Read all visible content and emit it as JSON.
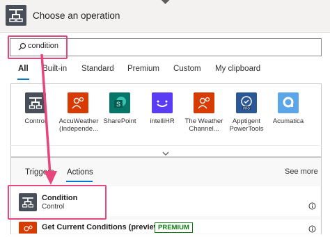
{
  "header": {
    "title": "Choose an operation"
  },
  "search": {
    "value": "condition"
  },
  "tabs": [
    "All",
    "Built-in",
    "Standard",
    "Premium",
    "Custom",
    "My clipboard"
  ],
  "connectors": [
    {
      "label": "Control",
      "color": "#484f58",
      "icon": "control-icon"
    },
    {
      "label": "AccuWeather (Independe...",
      "color": "#d83b01",
      "icon": "accuweather-icon"
    },
    {
      "label": "SharePoint",
      "color": "#077568",
      "icon": "sharepoint-icon"
    },
    {
      "label": "intelliHR",
      "color": "#5b3cf5",
      "icon": "intellihr-icon"
    },
    {
      "label": "The Weather Channel...",
      "color": "#d83b01",
      "icon": "weather-channel-icon"
    },
    {
      "label": "Apptigent PowerTools",
      "color": "#2b5797",
      "icon": "apptigent-icon"
    },
    {
      "label": "Acumatica",
      "color": "#5aa6e8",
      "icon": "acumatica-icon"
    }
  ],
  "subtabs": {
    "triggers": "Triggers",
    "actions": "Actions"
  },
  "see_more": "See more",
  "actions": [
    {
      "title": "Condition",
      "subtitle": "Control"
    },
    {
      "title": "Get Current Conditions (preview)",
      "badge": "PREMIUM"
    }
  ],
  "colors": {
    "accent": "#0078d4",
    "highlight": "#e8457c",
    "premium_badge": "#107c10"
  }
}
